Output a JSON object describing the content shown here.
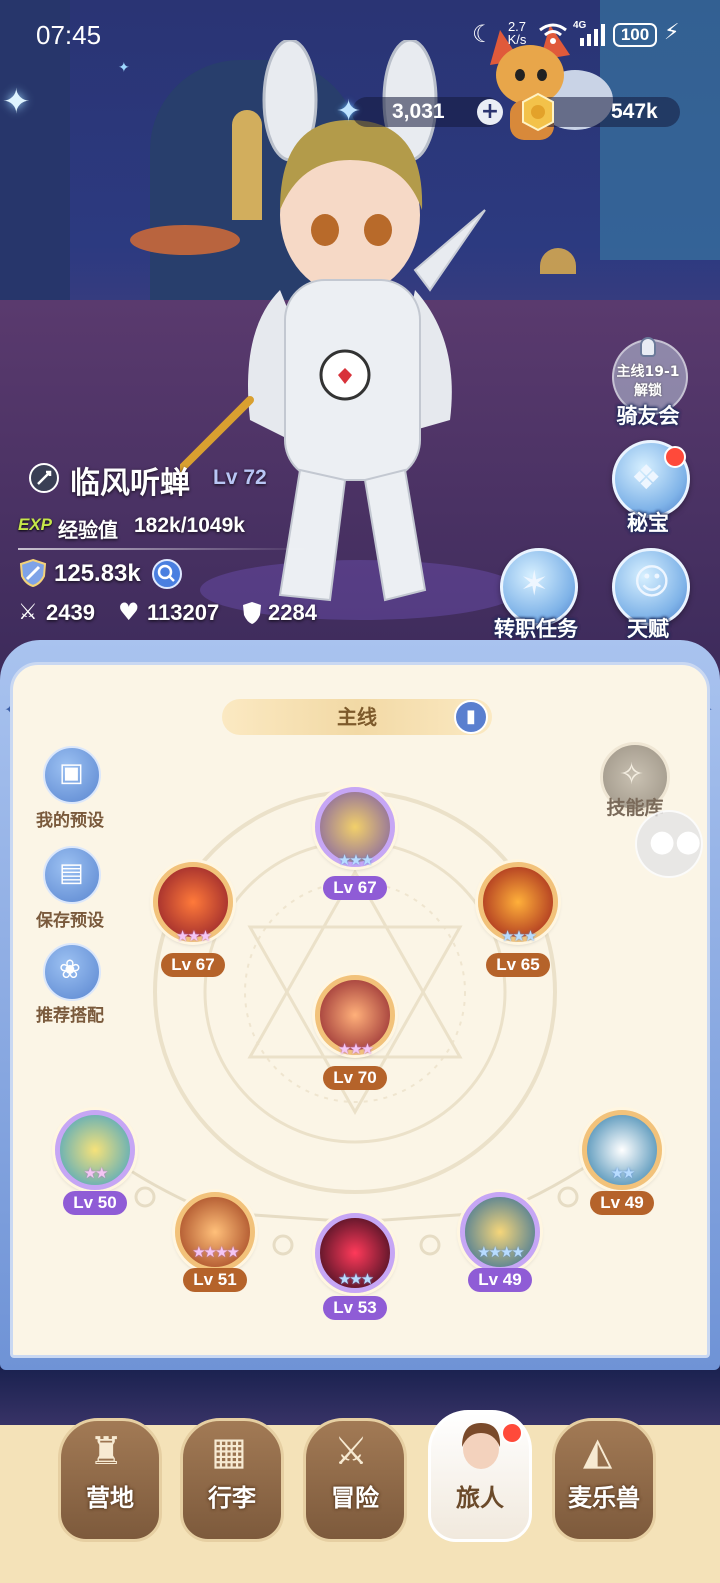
{
  "status_bar": {
    "time": "07:45",
    "net_speed_top": "2.7",
    "net_speed_unit": "K/s",
    "network": "4G",
    "battery": "100"
  },
  "resources": {
    "stars": "3,031",
    "plus_icon": "plus-icon",
    "gold": "547k"
  },
  "character": {
    "name": "临风听蝉",
    "level": "Lv 72",
    "exp_badge": "EXP",
    "exp_label": "经验值",
    "exp_value": "182k/1049k",
    "power": "125.83k",
    "attack": "2439",
    "hp": "113207",
    "defense": "2284"
  },
  "side_buttons": {
    "riders_lock_line1": "主线19-1",
    "riders_lock_line2": "解锁",
    "riders": "骑友会",
    "treasure": "秘宝",
    "job_quest": "转职任务",
    "talent": "天赋"
  },
  "panel": {
    "tab": "主线",
    "skill_library": "技能库",
    "left_buttons": [
      "我的预设",
      "保存预设",
      "推荐搭配"
    ]
  },
  "skills": {
    "top": {
      "level": "Lv 67",
      "stars": "★★★"
    },
    "upper_left": {
      "level": "Lv 67",
      "stars": "★★★"
    },
    "upper_right": {
      "level": "Lv 65",
      "stars": "★★★"
    },
    "center": {
      "level": "Lv 70",
      "stars": "★★★"
    },
    "b1": {
      "level": "Lv 50",
      "stars": "★★"
    },
    "b2": {
      "level": "Lv 51",
      "stars": "★★★★"
    },
    "b3": {
      "level": "Lv 53",
      "stars": "★★★"
    },
    "b4": {
      "level": "Lv 49",
      "stars": "★★★★"
    },
    "b5": {
      "level": "Lv 49",
      "stars": "★★"
    }
  },
  "nav": {
    "items": [
      "营地",
      "行李",
      "冒险",
      "旅人",
      "麦乐兽"
    ],
    "active": "旅人"
  },
  "colors": {
    "panel_bg": "#fbf5e6",
    "level_orange": "#b5632a",
    "level_violet": "#8f5cd6",
    "accent_blue": "#6f93d6",
    "badge_red": "#ff4a3a"
  }
}
